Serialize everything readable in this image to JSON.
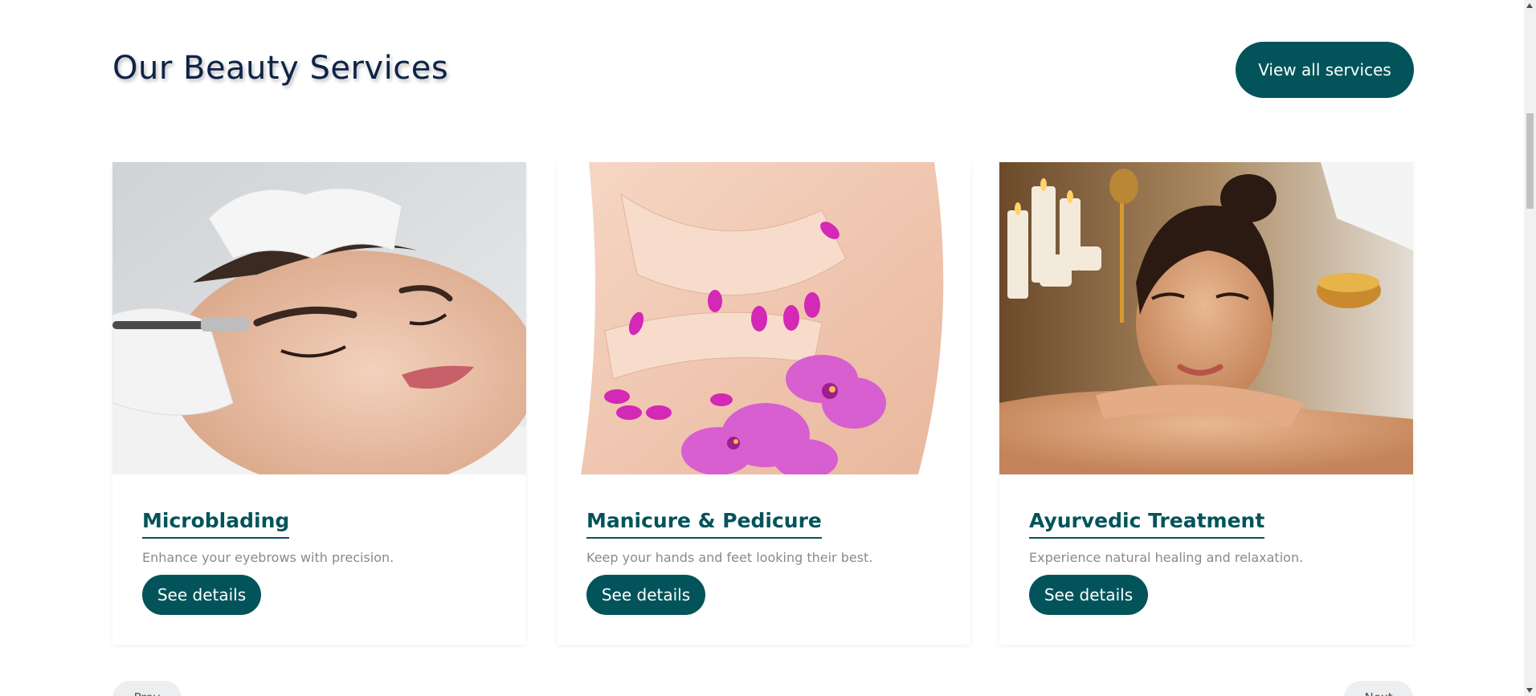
{
  "section": {
    "title": "Our Beauty Services",
    "view_all_label": "View all services"
  },
  "services": [
    {
      "title": "Microblading",
      "description": "Enhance your eyebrows with precision.",
      "button_label": "See details"
    },
    {
      "title": "Manicure & Pedicure",
      "description": "Keep your hands and feet looking their best.",
      "button_label": "See details"
    },
    {
      "title": "Ayurvedic Treatment",
      "description": "Experience natural healing and relaxation.",
      "button_label": "See details"
    }
  ],
  "pagination": {
    "prev_label": "Prev",
    "next_label": "Next"
  },
  "colors": {
    "accent": "#03545a",
    "heading": "#0f2347",
    "muted_text": "#8a8a8a"
  }
}
